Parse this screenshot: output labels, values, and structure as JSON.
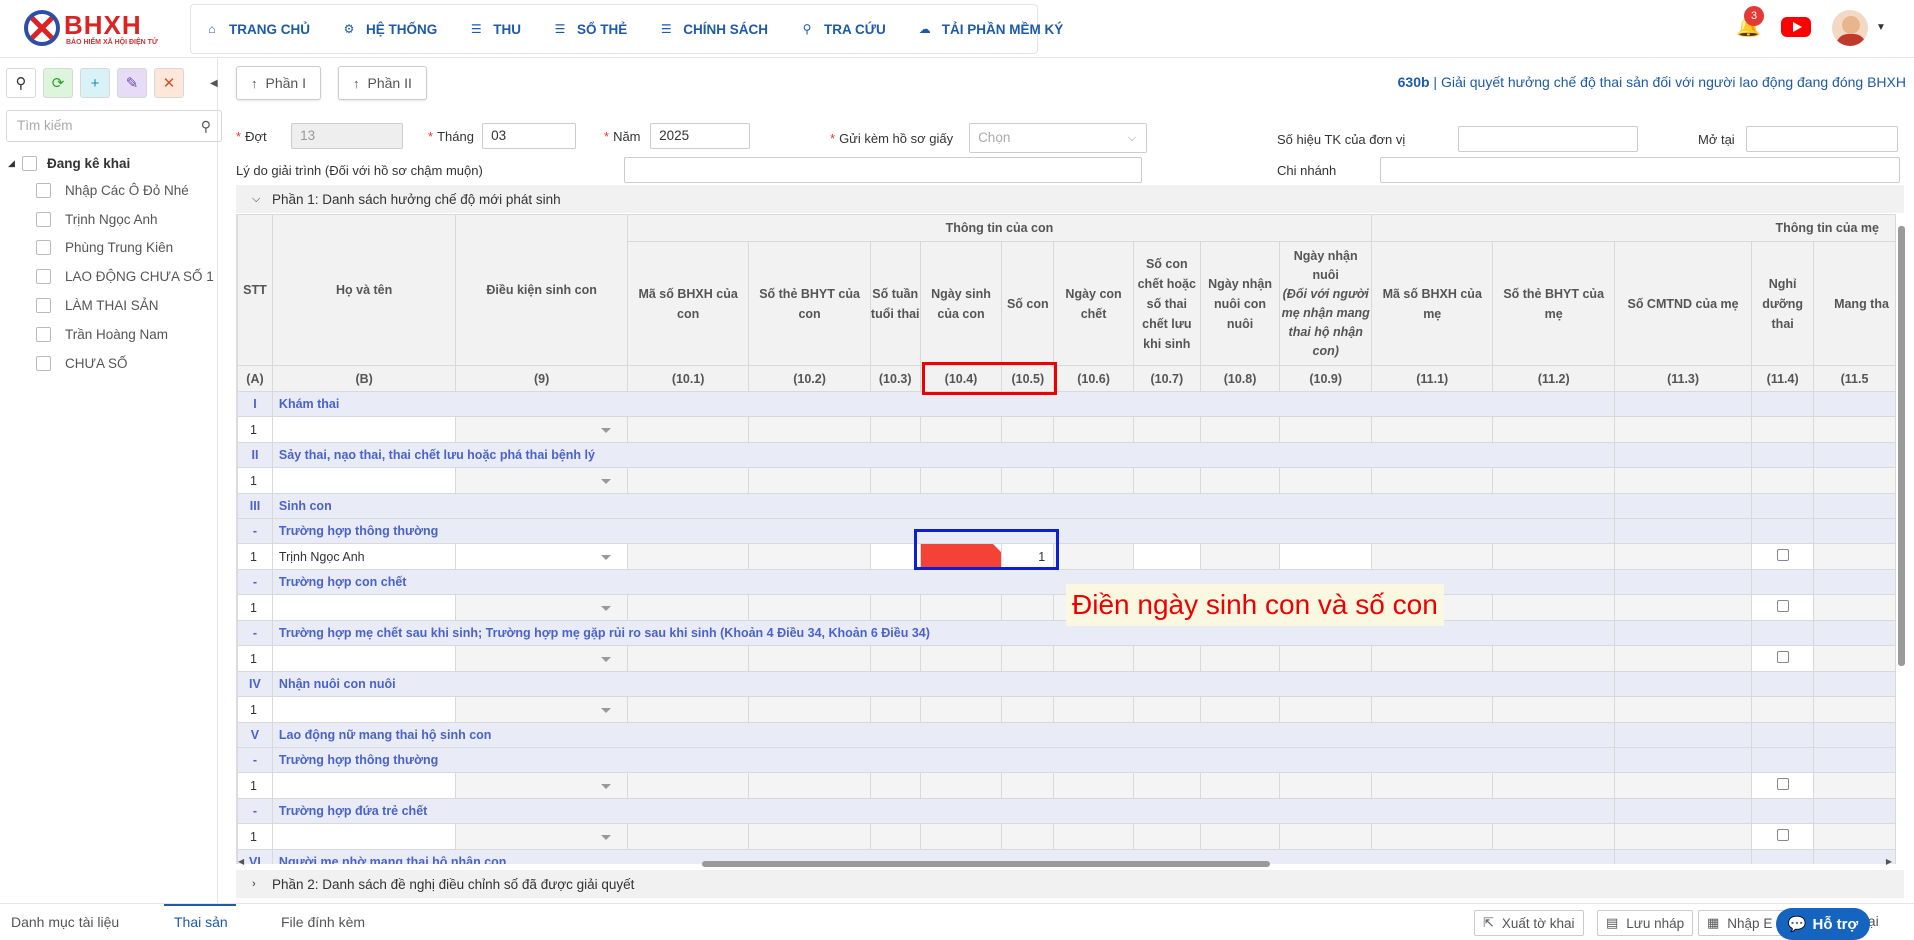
{
  "brand": {
    "logo_text": "BHXH",
    "logo_subtitle": "BẢO HIỂM XÃ HỘI ĐIỆN TỬ"
  },
  "nav": [
    {
      "label": "TRANG CHỦ",
      "icon": "home-icon"
    },
    {
      "label": "HỆ THỐNG",
      "icon": "gear-icon"
    },
    {
      "label": "THU",
      "icon": "document-icon"
    },
    {
      "label": "SỔ THẺ",
      "icon": "card-icon"
    },
    {
      "label": "CHÍNH SÁCH",
      "icon": "policy-icon"
    },
    {
      "label": "TRA CỨU",
      "icon": "search-icon"
    },
    {
      "label": "TẢI PHẦN MỀM KÝ",
      "icon": "download-icon"
    }
  ],
  "notifications": {
    "count": "3"
  },
  "sidebar": {
    "search_placeholder": "Tìm kiếm",
    "root_label": "Đang kê khai",
    "items": [
      "Nhập Các Ô Đỏ Nhé",
      "Trịnh Ngọc Anh",
      "Phùng Trung Kiên",
      "LAO ĐỘNG CHƯA SỐ 1",
      "LÀM THAI SẢN",
      "Trần Hoàng Nam",
      "CHƯA SỐ"
    ]
  },
  "parts": {
    "part1": "Phần I",
    "part2": "Phần II"
  },
  "form_title": {
    "code": "630b",
    "sep": " | ",
    "text": "Giải quyết hưởng chế độ thai sản đối với người lao động đang đóng BHXH"
  },
  "form": {
    "dot_label": "Đợt",
    "dot_value": "13",
    "thang_label": "Tháng",
    "thang_value": "03",
    "nam_label": "Năm",
    "nam_value": "2025",
    "gui_label": "Gửi kèm hồ sơ giấy",
    "gui_placeholder": "Chọn",
    "sohieu_label": "Số hiệu TK của đơn vị",
    "mo_tai_label": "Mở tại",
    "lydo_label": "Lý do giải trình (Đối với hồ sơ chậm muộn)",
    "chinhanh_label": "Chi nhánh"
  },
  "section1": "Phần 1: Danh sách hưởng chế độ mới phát sinh",
  "section2": "Phần 2: Danh sách đề nghị điều chỉnh số đã được giải quyết",
  "table": {
    "h_stt": "STT",
    "h_name": "Họ và tên",
    "h_cond": "Điều kiện sinh con",
    "h_group_con": "Thông tin của con",
    "h_group_me": "Thông tin của mẹ",
    "h_101": "Mã số BHXH của con",
    "h_102": "Số thẻ BHYT của con",
    "h_103": "Số tuần tuổi thai",
    "h_104": "Ngày sinh của con",
    "h_105": "Số con",
    "h_106": "Ngày con chết",
    "h_107": "Số con chết hoặc số thai chết lưu khi sinh",
    "h_108": "Ngày nhận nuôi con nuôi",
    "h_109a": "Ngày nhận nuôi",
    "h_109b": "(Đối với người mẹ nhận mang thai hộ nhận con)",
    "h_111": "Mã số BHXH của mẹ",
    "h_112": "Số thẻ BHYT của mẹ",
    "h_113": "Số CMTND của mẹ",
    "h_114": "Nghỉ dưỡng thai",
    "h_115": "Mang tha",
    "codes": [
      "(A)",
      "(B)",
      "(9)",
      "(10.1)",
      "(10.2)",
      "(10.3)",
      "(10.4)",
      "(10.5)",
      "(10.6)",
      "(10.7)",
      "(10.8)",
      "(10.9)",
      "(11.1)",
      "(11.2)",
      "(11.3)",
      "(11.4)",
      "(11.5"
    ],
    "groups": {
      "g1": {
        "stt": "I",
        "name": "Khám thai"
      },
      "g2": {
        "stt": "II",
        "name": "Sảy thai, nạo thai, thai chết lưu hoặc phá thai bệnh lý"
      },
      "g3": {
        "stt": "III",
        "name": "Sinh con"
      },
      "g3a": {
        "stt": "-",
        "name": "Trường hợp thông thường"
      },
      "g3b": {
        "stt": "-",
        "name": "Trường hợp con chết"
      },
      "g3c": {
        "stt": "-",
        "name": "Trường hợp mẹ chết sau khi sinh; Trường hợp mẹ gặp rủi ro sau khi sinh (Khoản 4 Điều 34, Khoản 6 Điều 34)"
      },
      "g4": {
        "stt": "IV",
        "name": "Nhận nuôi con nuôi"
      },
      "g5": {
        "stt": "V",
        "name": "Lao động nữ mang thai hộ sinh con"
      },
      "g5a": {
        "stt": "-",
        "name": "Trường hợp thông thường"
      },
      "g5b": {
        "stt": "-",
        "name": "Trường hợp đứa trẻ chết"
      },
      "g6": {
        "stt": "VI",
        "name": "Người mẹ nhờ mang thai hộ nhận con"
      }
    },
    "row_stt": "1",
    "person_name": "Trịnh Ngọc Anh",
    "so_con": "1"
  },
  "annotation": "Điền ngày sinh con và số con",
  "bottom": {
    "tabs": [
      "Danh mục tài liệu",
      "Thai sản",
      "File đính kèm"
    ],
    "btn_xuat": "Xuất tờ khai",
    "btn_luu": "Lưu nháp",
    "btn_nhap": "Nhập E",
    "btn_lai": "ây lại",
    "help": "Hỗ trợ"
  },
  "colors": {
    "accent": "#1d5aa8",
    "group_text": "#4a63c9",
    "highlight_red": "#ee0000",
    "highlight_blue": "#0a1fd6",
    "required_cell": "#f44336"
  }
}
